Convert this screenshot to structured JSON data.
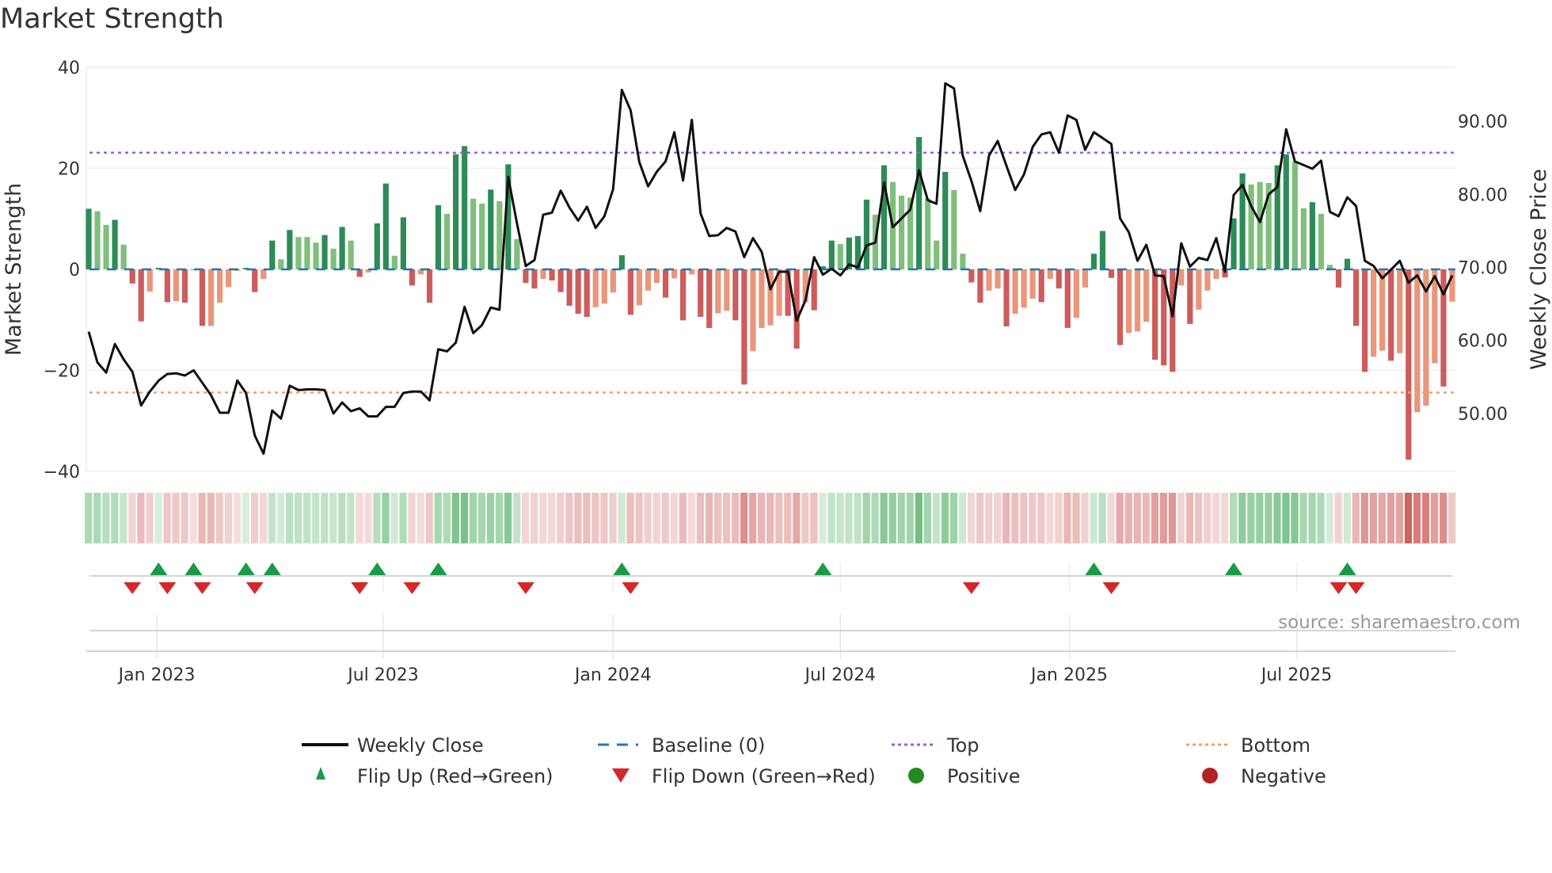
{
  "chart_data": {
    "type": "bar",
    "title": "Market Strength",
    "ylabel": "Market Strength",
    "y2label": "Weekly Close Price",
    "ylim": [
      -40,
      40
    ],
    "y2lim": [
      42,
      97
    ],
    "yticks": [
      "40",
      "20",
      "0",
      "−20",
      "−40"
    ],
    "ytick_values": [
      40,
      20,
      0,
      -20,
      -40
    ],
    "y2ticks": [
      "90.00",
      "80.00",
      "70.00",
      "60.00",
      "50.00"
    ],
    "y2tick_values": [
      90,
      80,
      70,
      60,
      50
    ],
    "xticks": [
      {
        "label": "Jan 2023",
        "week": 7.8
      },
      {
        "label": "Jul 2023",
        "week": 33.7
      },
      {
        "label": "Jan 2024",
        "week": 60.0
      },
      {
        "label": "Jul 2024",
        "week": 86.0
      },
      {
        "label": "Jan 2025",
        "week": 112.2
      },
      {
        "label": "Jul 2025",
        "week": 138.2
      }
    ],
    "top_level": 23.1,
    "bottom_level": -24.4,
    "strength": [
      12,
      11.5,
      8.8,
      9.8,
      4.9,
      -2.8,
      -10.3,
      -4.4,
      0.3,
      -6.5,
      -6.3,
      -6.6,
      -0.2,
      -11.2,
      -11.2,
      -6.6,
      -3.5,
      -0.3,
      0.3,
      -4.5,
      -1.9,
      5.7,
      2.0,
      7.8,
      6.4,
      6.4,
      5.3,
      6.8,
      4.1,
      8.4,
      5.7,
      -1.5,
      -0.6,
      9.1,
      17.0,
      2.7,
      10.3,
      -3.2,
      -1.0,
      -6.6,
      12.7,
      11.0,
      22.8,
      24.4,
      14,
      13,
      15.8,
      13.5,
      20.8,
      6,
      -2.7,
      -3.8,
      -1.9,
      -2.2,
      -4.5,
      -7.2,
      -8.8,
      -9.4,
      -7.5,
      -6.8,
      -4.6,
      2.8,
      -9.0,
      -7.1,
      -4.2,
      -2.7,
      -5.6,
      -1.8,
      -10.1,
      -1.0,
      -9.4,
      -11.6,
      -8.7,
      -8.2,
      -10.1,
      -22.8,
      -16.2,
      -11.6,
      -11.1,
      -9.2,
      -9.2,
      -15.7,
      -6.5,
      -8.1,
      0.6,
      5.7,
      5.0,
      6.3,
      6.6,
      13.8,
      10.8,
      20.6,
      17.3,
      14.6,
      14.2,
      26.2,
      14.0,
      5.7,
      19.3,
      15.7,
      3.1,
      -2.6,
      -6.6,
      -4.2,
      -3.8,
      -11.3,
      -8.8,
      -7.6,
      -5.8,
      -6.5,
      -1.9,
      -3.8,
      -11.6,
      -9.6,
      -3.6,
      3.1,
      7.6,
      -1.7,
      -15,
      -12.6,
      -12.3,
      -10.4,
      -17.9,
      -19,
      -20.3,
      -3.2,
      -10.8,
      -8.0,
      -4.2,
      -1.9,
      -1.6,
      10.1,
      19.0,
      16.8,
      17.3,
      17.1,
      20.6,
      22.8,
      21.3,
      12.1,
      13.3,
      11.0,
      0.9,
      -3.6,
      2.1,
      -11.2,
      -20.3,
      -17.3,
      -16.1,
      -18.1,
      -16.6,
      -37.7,
      -28.3,
      -27.0,
      -18.6,
      -23.2,
      -6.4
    ],
    "strong": [
      1,
      0,
      0,
      1,
      0,
      1,
      1,
      0,
      1,
      1,
      0,
      1,
      0,
      1,
      0,
      0,
      0,
      0,
      1,
      1,
      0,
      1,
      0,
      1,
      0,
      0,
      0,
      1,
      0,
      1,
      0,
      1,
      0,
      1,
      1,
      0,
      1,
      1,
      0,
      1,
      1,
      0,
      1,
      1,
      0,
      0,
      1,
      0,
      1,
      0,
      1,
      1,
      0,
      1,
      1,
      1,
      1,
      1,
      0,
      0,
      0,
      1,
      1,
      0,
      0,
      0,
      1,
      0,
      1,
      0,
      1,
      1,
      0,
      0,
      1,
      1,
      0,
      0,
      0,
      0,
      1,
      1,
      0,
      1,
      1,
      1,
      0,
      1,
      1,
      1,
      0,
      1,
      0,
      0,
      0,
      1,
      0,
      0,
      1,
      0,
      0,
      1,
      1,
      0,
      0,
      1,
      0,
      0,
      0,
      1,
      0,
      1,
      1,
      0,
      0,
      1,
      1,
      1,
      1,
      0,
      0,
      0,
      1,
      1,
      1,
      0,
      1,
      0,
      0,
      0,
      1,
      1,
      1,
      0,
      0,
      0,
      1,
      1,
      0,
      0,
      1,
      0,
      0,
      1,
      1,
      1,
      1,
      0,
      0,
      1,
      0,
      1,
      0,
      0,
      0,
      1,
      0
    ],
    "weekly_close": [
      61.2,
      57.0,
      55.6,
      59.5,
      57.4,
      55.7,
      51.1,
      53.0,
      54.5,
      55.4,
      55.5,
      55.2,
      55.9,
      54.2,
      52.5,
      50.1,
      50.1,
      54.5,
      52.8,
      47.0,
      44.5,
      50.4,
      49.3,
      53.8,
      53.2,
      53.3,
      53.3,
      53.2,
      50.0,
      51.5,
      50.3,
      50.7,
      49.6,
      49.6,
      50.9,
      50.9,
      52.8,
      53.0,
      53.0,
      51.8,
      58.8,
      58.5,
      59.7,
      64.6,
      61.0,
      62.1,
      64.5,
      64.2,
      82.4,
      76.0,
      70.2,
      71.0,
      77.2,
      77.5,
      80.5,
      78.2,
      76.4,
      78.3,
      75.4,
      77.0,
      80.7,
      94.3,
      91.5,
      84.4,
      81.1,
      83.1,
      84.5,
      88.5,
      81.9,
      90.2,
      77.4,
      74.3,
      74.4,
      75.4,
      74.9,
      71.4,
      74.0,
      72.1,
      67.0,
      69.4,
      69.4,
      62.7,
      65.5,
      71.4,
      69.0,
      69.8,
      68.9,
      70.4,
      70.0,
      73.0,
      73.4,
      81.6,
      75.5,
      76.7,
      77.9,
      83.3,
      79.2,
      78.7,
      95.2,
      94.5,
      85.3,
      81.8,
      77.7,
      85.3,
      87.3,
      83.9,
      80.6,
      82.7,
      86.5,
      88.2,
      88.5,
      85.7,
      90.8,
      90.2,
      86.1,
      88.5,
      87.7,
      86.9,
      76.7,
      74.8,
      70.9,
      73.1,
      68.9,
      68.8,
      63.3,
      73.3,
      70.1,
      71.3,
      71.0,
      74.0,
      69.4,
      79.9,
      81.3,
      78.4,
      76.2,
      80.0,
      81.0,
      88.9,
      84.5,
      84.0,
      83.5,
      84.6,
      77.6,
      77.0,
      79.6,
      78.4,
      70.9,
      70.2,
      68.5,
      69.7,
      70.9,
      67.9,
      68.9,
      66.7,
      68.8,
      66.3,
      68.9
    ],
    "flip_up_weeks": [
      8,
      12,
      18,
      21,
      33,
      40,
      61,
      84,
      115,
      131,
      144
    ],
    "flip_down_weeks": [
      5,
      9,
      13,
      19,
      31,
      37,
      50,
      62,
      101,
      117,
      143,
      145
    ],
    "legend": {
      "weekly_close": "Weekly Close",
      "baseline": "Baseline (0)",
      "top": "Top",
      "bottom": "Bottom",
      "flip_up": "Flip Up (Red→Green)",
      "flip_down": "Flip Down (Green→Red)",
      "positive": "Positive",
      "negative": "Negative",
      "placement": "bottom"
    },
    "source": "source: sharemaestro.com",
    "colors": {
      "strong_green": "#2e8b57",
      "light_green": "#7fbf7b",
      "strong_red": "#cd5c5c",
      "light_red": "#e9967a",
      "baseline": "#1f77b4",
      "top": "#9a5fd6",
      "bottom": "#f0a060",
      "flip_up": "#1a9a48",
      "flip_down": "#d62728",
      "positive": "#228b22",
      "negative": "#b22222"
    }
  }
}
